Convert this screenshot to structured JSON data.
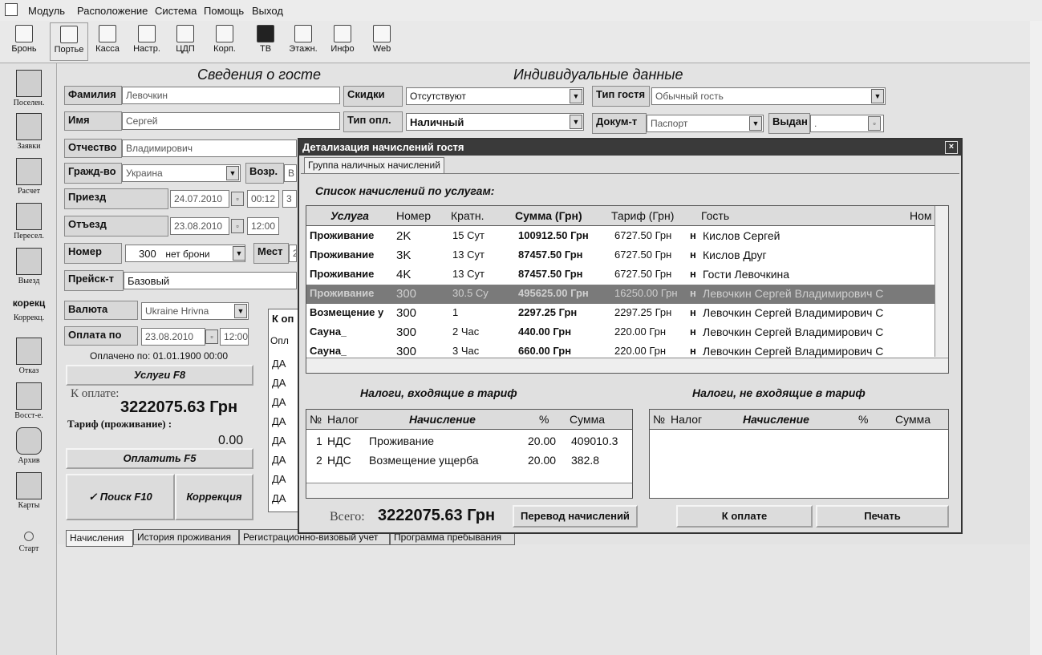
{
  "menu": {
    "items": [
      "Модуль",
      "Расположение",
      "Система",
      "Помощь",
      "Выход"
    ]
  },
  "toolbar": {
    "items": [
      "Бронь",
      "Портье",
      "Касса",
      "Настр.",
      "ЦДП",
      "Корп.",
      "ТВ",
      "Этажн.",
      "Инфо",
      "Web"
    ]
  },
  "sidebar": {
    "items": [
      "Поселен.",
      "Заявки",
      "Расчет",
      "Пересел.",
      "Выезд",
      "Коррекц.",
      "Отказ",
      "Восст-е.",
      "Архив",
      "Карты",
      "Старт"
    ],
    "korek_label": "корекц"
  },
  "guest": {
    "section_title": "Сведения о госте",
    "individual_title": "Индивидуальные данные",
    "surname_label": "Фамилия",
    "surname": "Левочкин",
    "name_label": "Имя",
    "name": "Сергей",
    "patronymic_label": "Отчество",
    "patronymic": "Владимирович",
    "citizenship_label": "Гражд-во",
    "citizenship": "Украина",
    "age_label": "Возр.",
    "age": "В",
    "arrival_label": "Приезд",
    "arrival_date": "24.07.2010",
    "arrival_time": "00:12",
    "arrival_extra": "3",
    "departure_label": "Отъезд",
    "departure_date": "23.08.2010",
    "departure_time": "12:00",
    "room_label": "Номер",
    "room": "300",
    "room_status": "нет брони",
    "place_label": "Мест",
    "place": "2",
    "pricelist_label": "Прейск-т",
    "pricelist": "Базовый",
    "discount_label": "Скидки",
    "discount": "Отсутствуют",
    "paytype_label": "Тип опл.",
    "paytype": "Наличный",
    "guesttype_label": "Тип гостя",
    "guesttype": "Обычный гость",
    "doc_label": "Докум-т",
    "doc": "Паспорт",
    "issued_label": "Выдан",
    "issued": "."
  },
  "payment": {
    "currency_label": "Валюта",
    "currency": "Ukraine Hrivna",
    "payuntil_label": "Оплата по",
    "payuntil_date": "23.08.2010",
    "payuntil_time": "12:00",
    "paid_note": "Оплачено по: 01.01.1900 00:00",
    "services_button": "Услуги F8",
    "topay_label": "К оплате:",
    "topay_amount": "3222075.63 Грн",
    "tariff_label": "Тариф (проживание) :",
    "tariff_value": "0.00",
    "pay_button": "Оплатить F5",
    "search_button": "Поиск F10",
    "correction_button": "Коррекция"
  },
  "bg_column": {
    "header": "К оп",
    "subheader": "Опл",
    "values": [
      "ДА",
      "ДА",
      "ДА",
      "ДА",
      "ДА",
      "ДА",
      "ДА",
      "ДА",
      "ДА"
    ]
  },
  "dialog": {
    "title": "Детализация начислений гостя",
    "tab": "Группа наличных начислений",
    "list_title": "Список начислений по услугам:",
    "columns": [
      "Услуга",
      "Номер",
      "Кратн.",
      "Сумма (Грн)",
      "Тариф (Грн)",
      "Гость",
      "Ном"
    ],
    "rows": [
      {
        "service": "Проживание",
        "room": "2K",
        "mult": "15 Сут",
        "sum": "100912.50 Грн",
        "tariff": "6727.50 Грн",
        "flag": "н",
        "guest": "Кислов Сергей"
      },
      {
        "service": "Проживание",
        "room": "3K",
        "mult": "13 Сут",
        "sum": "87457.50 Грн",
        "tariff": "6727.50 Грн",
        "flag": "н",
        "guest": "Кислов Друг"
      },
      {
        "service": "Проживание",
        "room": "4K",
        "mult": "13 Сут",
        "sum": "87457.50 Грн",
        "tariff": "6727.50 Грн",
        "flag": "н",
        "guest": "Гости Левочкина"
      },
      {
        "service": "Проживание",
        "room": "300",
        "mult": "30.5 Су",
        "sum": "495625.00 Грн",
        "tariff": "16250.00 Грн",
        "flag": "н",
        "guest": "Левочкин Сергей Владимирович С"
      },
      {
        "service": "Возмещение у",
        "room": "300",
        "mult": "1",
        "sum": "2297.25 Грн",
        "tariff": "2297.25 Грн",
        "flag": "н",
        "guest": "Левочкин Сергей Владимирович С"
      },
      {
        "service": "Сауна_",
        "room": "300",
        "mult": "2 Час",
        "sum": "440.00 Грн",
        "tariff": "220.00 Грн",
        "flag": "н",
        "guest": "Левочкин Сергей Владимирович С"
      },
      {
        "service": "Сауна_",
        "room": "300",
        "mult": "3 Час",
        "sum": "660.00 Грн",
        "tariff": "220.00 Грн",
        "flag": "н",
        "guest": "Левочкин Сергей Владимирович С"
      }
    ],
    "taxes_in_title": "Налоги, входящие в тариф",
    "taxes_out_title": "Налоги, не входящие в тариф",
    "tax_columns": [
      "№",
      "Налог",
      "Начисление",
      "%",
      "Сумма"
    ],
    "taxes_in": [
      {
        "n": "1",
        "tax": "НДС",
        "charge": "Проживание",
        "pct": "20.00",
        "sum": "409010.3"
      },
      {
        "n": "2",
        "tax": "НДС",
        "charge": "Возмещение ущерба",
        "pct": "20.00",
        "sum": "382.8"
      }
    ],
    "total_label": "Всего:",
    "total": "3222075.63 Грн",
    "transfer_button": "Перевод начислений",
    "topay_button": "К оплате",
    "print_button": "Печать"
  },
  "bottom_tabs": [
    "Начисления",
    "История проживания",
    "Регистрационно-визовый учет",
    "Программа пребывания"
  ]
}
